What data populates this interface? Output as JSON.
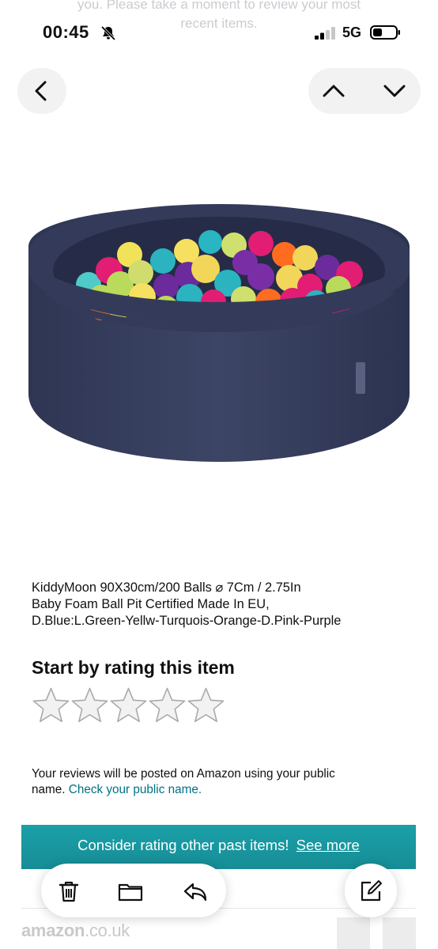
{
  "background_header": {
    "line1": "you. Please take a moment to review your most",
    "line2": "recent items."
  },
  "status_bar": {
    "time": "00:45",
    "network": "5G"
  },
  "navigation": {
    "back_icon": "chevron-left-icon",
    "previous_icon": "chevron-up-icon",
    "next_icon": "chevron-down-icon"
  },
  "product": {
    "image_icon": "ball-pit-image",
    "title_line1": "KiddyMoon 90X30cm/200 Balls ⌀ 7Cm / 2.75In",
    "title_line2": "Baby Foam Ball Pit Certified Made In EU,",
    "title_line3": "D.Blue:L.Green-Yellw-Turquois-Orange-D.Pink-Purple"
  },
  "rating": {
    "heading": "Start by rating this item",
    "max_stars": 5,
    "selected_stars": 0
  },
  "notice": {
    "text_line1": "Your reviews will be posted on Amazon using your public",
    "text_line2": "name.",
    "link": "Check your public name."
  },
  "banner": {
    "text": "Consider rating other past items!",
    "link": "See more",
    "color": "#1a9aa4"
  },
  "toolbar": {
    "icons": [
      "trash-icon",
      "folder-icon",
      "reply-icon",
      "compose-icon"
    ]
  },
  "footer": {
    "logo_main": "amazon",
    "logo_suffix": ".co.uk"
  }
}
